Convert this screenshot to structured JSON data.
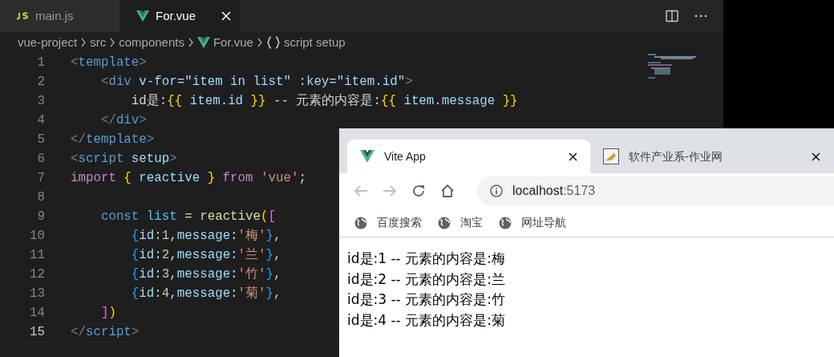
{
  "editor": {
    "tabs": [
      {
        "label": "main.js",
        "kind": "js",
        "selected": false
      },
      {
        "label": "For.vue",
        "kind": "vue",
        "selected": true
      }
    ],
    "breadcrumb": [
      {
        "label": "vue-project",
        "kind": "folder"
      },
      {
        "label": "src",
        "kind": "folder"
      },
      {
        "label": "components",
        "kind": "folder"
      },
      {
        "label": "For.vue",
        "kind": "vue"
      },
      {
        "label": "script setup",
        "kind": "symbol"
      }
    ],
    "lines": [
      {
        "number": "1",
        "current": false,
        "tokens": [
          {
            "text": "<",
            "kind": "punct"
          },
          {
            "text": "template",
            "kind": "tag"
          },
          {
            "text": ">",
            "kind": "punct"
          }
        ]
      },
      {
        "number": "2",
        "current": false,
        "tokens": [
          {
            "text": "    <",
            "kind": "punct"
          },
          {
            "text": "div",
            "kind": "tag"
          },
          {
            "text": " v-for",
            "kind": "attr"
          },
          {
            "text": "=",
            "kind": "text"
          },
          {
            "text": "\"item in list\"",
            "kind": "expr"
          },
          {
            "text": " :key",
            "kind": "attr"
          },
          {
            "text": "=",
            "kind": "text"
          },
          {
            "text": "\"item.id\"",
            "kind": "expr"
          },
          {
            "text": ">",
            "kind": "punct"
          }
        ]
      },
      {
        "number": "3",
        "current": false,
        "tokens": [
          {
            "text": "        id是:",
            "kind": "text"
          },
          {
            "text": "{{",
            "kind": "brace1"
          },
          {
            "text": " item.id ",
            "kind": "expr"
          },
          {
            "text": "}}",
            "kind": "brace1"
          },
          {
            "text": " -- 元素的内容是:",
            "kind": "text"
          },
          {
            "text": "{{",
            "kind": "brace1"
          },
          {
            "text": " item.message ",
            "kind": "expr"
          },
          {
            "text": "}}",
            "kind": "brace1"
          }
        ]
      },
      {
        "number": "4",
        "current": false,
        "tokens": [
          {
            "text": "    </",
            "kind": "punct"
          },
          {
            "text": "div",
            "kind": "tag"
          },
          {
            "text": ">",
            "kind": "punct"
          }
        ]
      },
      {
        "number": "5",
        "current": false,
        "tokens": [
          {
            "text": "</",
            "kind": "punct"
          },
          {
            "text": "template",
            "kind": "tag"
          },
          {
            "text": ">",
            "kind": "punct"
          }
        ]
      },
      {
        "number": "6",
        "current": false,
        "tokens": [
          {
            "text": "<",
            "kind": "punct"
          },
          {
            "text": "script",
            "kind": "tag"
          },
          {
            "text": " setup",
            "kind": "attr"
          },
          {
            "text": ">",
            "kind": "punct"
          }
        ]
      },
      {
        "number": "7",
        "current": false,
        "tokens": [
          {
            "text": "import",
            "kind": "keyword"
          },
          {
            "text": " {",
            "kind": "brace1"
          },
          {
            "text": " reactive ",
            "kind": "expr"
          },
          {
            "text": "}",
            "kind": "brace1"
          },
          {
            "text": " from",
            "kind": "keyword"
          },
          {
            "text": " 'vue'",
            "kind": "str"
          },
          {
            "text": ";",
            "kind": "text"
          }
        ]
      },
      {
        "number": "8",
        "current": false
      },
      {
        "number": "9",
        "current": false,
        "tokens": [
          {
            "text": "    const",
            "kind": "storage"
          },
          {
            "text": " list",
            "kind": "var"
          },
          {
            "text": " = ",
            "kind": "text"
          },
          {
            "text": "reactive",
            "kind": "fn"
          },
          {
            "text": "(",
            "kind": "brace1"
          },
          {
            "text": "[",
            "kind": "brace2"
          }
        ]
      },
      {
        "number": "10",
        "current": false,
        "tokens": [
          {
            "text": "        {",
            "kind": "brace3"
          },
          {
            "text": "id",
            "kind": "expr"
          },
          {
            "text": ":",
            "kind": "text"
          },
          {
            "text": "1",
            "kind": "num"
          },
          {
            "text": ",",
            "kind": "text"
          },
          {
            "text": "message",
            "kind": "expr"
          },
          {
            "text": ":",
            "kind": "text"
          },
          {
            "text": "'梅'",
            "kind": "str"
          },
          {
            "text": "}",
            "kind": "brace3"
          },
          {
            "text": ",",
            "kind": "text"
          }
        ]
      },
      {
        "number": "11",
        "current": false,
        "tokens": [
          {
            "text": "        {",
            "kind": "brace3"
          },
          {
            "text": "id",
            "kind": "expr"
          },
          {
            "text": ":",
            "kind": "text"
          },
          {
            "text": "2",
            "kind": "num"
          },
          {
            "text": ",",
            "kind": "text"
          },
          {
            "text": "message",
            "kind": "expr"
          },
          {
            "text": ":",
            "kind": "text"
          },
          {
            "text": "'兰'",
            "kind": "str"
          },
          {
            "text": "}",
            "kind": "brace3"
          },
          {
            "text": ",",
            "kind": "text"
          }
        ]
      },
      {
        "number": "12",
        "current": false,
        "tokens": [
          {
            "text": "        {",
            "kind": "brace3"
          },
          {
            "text": "id",
            "kind": "expr"
          },
          {
            "text": ":",
            "kind": "text"
          },
          {
            "text": "3",
            "kind": "num"
          },
          {
            "text": ",",
            "kind": "text"
          },
          {
            "text": "message",
            "kind": "expr"
          },
          {
            "text": ":",
            "kind": "text"
          },
          {
            "text": "'竹'",
            "kind": "str"
          },
          {
            "text": "}",
            "kind": "brace3"
          },
          {
            "text": ",",
            "kind": "text"
          }
        ]
      },
      {
        "number": "13",
        "current": false,
        "tokens": [
          {
            "text": "        {",
            "kind": "brace3"
          },
          {
            "text": "id",
            "kind": "expr"
          },
          {
            "text": ":",
            "kind": "text"
          },
          {
            "text": "4",
            "kind": "num"
          },
          {
            "text": ",",
            "kind": "text"
          },
          {
            "text": "message",
            "kind": "expr"
          },
          {
            "text": ":",
            "kind": "text"
          },
          {
            "text": "'菊'",
            "kind": "str"
          },
          {
            "text": "}",
            "kind": "brace3"
          },
          {
            "text": ",",
            "kind": "text"
          }
        ]
      },
      {
        "number": "14",
        "current": false,
        "tokens": [
          {
            "text": "    ]",
            "kind": "brace2"
          },
          {
            "text": ")",
            "kind": "brace1"
          }
        ]
      },
      {
        "number": "15",
        "current": true,
        "tokens": [
          {
            "text": "</",
            "kind": "punct"
          },
          {
            "text": "script",
            "kind": "tag"
          },
          {
            "text": ">",
            "kind": "punct"
          }
        ]
      }
    ]
  },
  "browser": {
    "tabs": [
      {
        "title": "Vite App",
        "kind": "vue",
        "selected": true
      },
      {
        "title": "软件产业系-作业网",
        "kind": "cat",
        "selected": false
      }
    ],
    "address": {
      "host": "localhost",
      "port": ":5173"
    },
    "bookmarks": [
      "百度搜索",
      "淘宝",
      "网址导航"
    ],
    "content_lines": [
      "id是:1 -- 元素的内容是:梅",
      "id是:2 -- 元素的内容是:兰",
      "id是:3 -- 元素的内容是:竹",
      "id是:4 -- 元素的内容是:菊"
    ]
  }
}
